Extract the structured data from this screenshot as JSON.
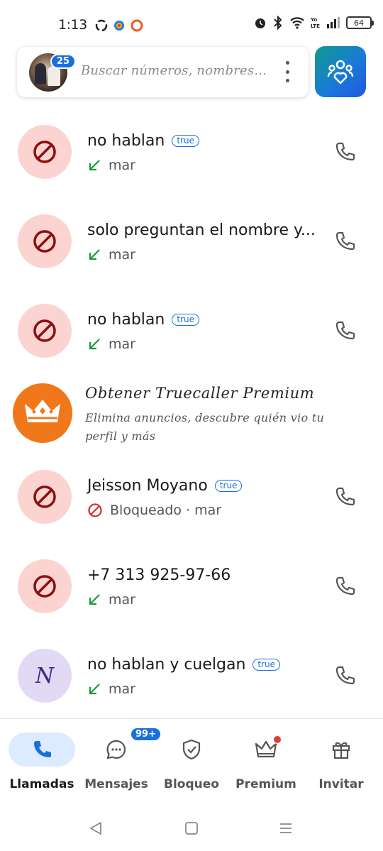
{
  "status_bar": {
    "time": "1:13",
    "battery": "64",
    "icons": [
      "sync-icon",
      "app-icon",
      "record-icon",
      "alarm-icon",
      "bluetooth-icon",
      "wifi-icon",
      "volte-icon",
      "signal-icon"
    ]
  },
  "header": {
    "avatar_badge": "25",
    "search_placeholder": "Buscar números, nombres...",
    "menu_icon": "kebab-icon",
    "family_icon": "family-icon",
    "accent_color": "#1a6fe0"
  },
  "calls": [
    {
      "name": "no hablan",
      "badge": "true",
      "sub": "mar",
      "status_icon": "incoming-arrow-icon",
      "avatar": "block-icon"
    },
    {
      "name": "solo preguntan el nombre y...",
      "badge": "",
      "sub": "mar",
      "status_icon": "incoming-arrow-icon",
      "avatar": "block-icon"
    },
    {
      "name": "no hablan",
      "badge": "true",
      "sub": "mar",
      "status_icon": "incoming-arrow-icon",
      "avatar": "block-icon"
    },
    {
      "name": "Jeisson Moyano",
      "badge": "true",
      "sub": "Bloqueado · mar",
      "status_icon": "blocked-icon",
      "avatar": "block-icon"
    },
    {
      "name": "+7 313 925-97-66",
      "badge": "",
      "sub": "mar",
      "status_icon": "incoming-arrow-icon",
      "avatar": "block-icon"
    },
    {
      "name": "no hablan y cuelgan",
      "badge": "true",
      "sub": "mar",
      "status_icon": "incoming-arrow-icon",
      "avatar_letter": "N"
    }
  ],
  "promo": {
    "title": "Obtener Truecaller Premium",
    "description": "Elimina anuncios, descubre quién vio tu perfil y más",
    "icon": "crown-icon"
  },
  "bottom_nav": [
    {
      "label": "Llamadas",
      "icon": "phone-icon",
      "active": true
    },
    {
      "label": "Mensajes",
      "icon": "chat-icon",
      "badge": "99+"
    },
    {
      "label": "Bloqueo",
      "icon": "shield-icon"
    },
    {
      "label": "Premium",
      "icon": "crown-icon",
      "dot": true
    },
    {
      "label": "Invitar",
      "icon": "gift-icon"
    }
  ],
  "system_nav": [
    "back-icon",
    "home-icon",
    "recents-icon"
  ]
}
